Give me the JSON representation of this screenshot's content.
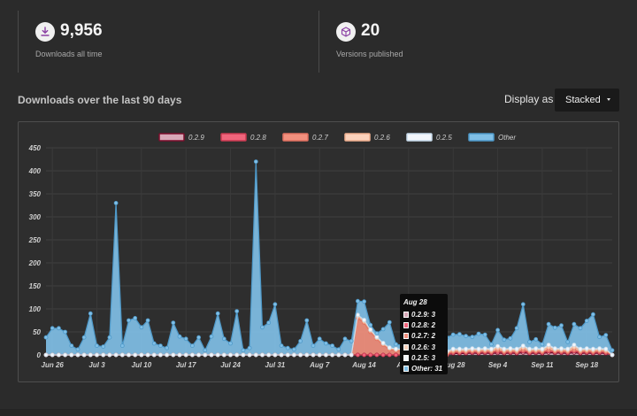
{
  "stats": [
    {
      "icon": "download-icon",
      "value": "9,956",
      "label": "Downloads all time"
    },
    {
      "icon": "package-icon",
      "value": "20",
      "label": "Versions published"
    }
  ],
  "section_title": "Downloads over the last 90 days",
  "display": {
    "label": "Display as",
    "selected": "Stacked"
  },
  "tooltip": {
    "title": "Aug 28",
    "rows": [
      {
        "text": "0.2.9: 3",
        "color": "#d8a8b7"
      },
      {
        "text": "0.2.8: 2",
        "color": "#f0657c"
      },
      {
        "text": "0.2.7: 2",
        "color": "#f2907e"
      },
      {
        "text": "0.2.6: 3",
        "color": "#fbd2bc"
      },
      {
        "text": "0.2.5: 3",
        "color": "#f2f6fb"
      },
      {
        "text": "Other: 31",
        "color": "#80bfe6"
      }
    ]
  },
  "chart_data": {
    "type": "area",
    "stacked": true,
    "legend_position": "top",
    "ylim": [
      0,
      450
    ],
    "yticks": [
      0,
      50,
      100,
      150,
      200,
      250,
      300,
      350,
      400,
      450
    ],
    "xtick_labels": [
      "Jun 26",
      "Jul 3",
      "Jul 10",
      "Jul 17",
      "Jul 24",
      "Jul 31",
      "Aug 7",
      "Aug 14",
      "Aug 21",
      "Aug 28",
      "Sep 4",
      "Sep 11",
      "Sep 18"
    ],
    "x": [
      "Jun 25",
      "Jun 26",
      "Jun 27",
      "Jun 28",
      "Jun 29",
      "Jun 30",
      "Jul 1",
      "Jul 2",
      "Jul 3",
      "Jul 4",
      "Jul 5",
      "Jul 6",
      "Jul 7",
      "Jul 8",
      "Jul 9",
      "Jul 10",
      "Jul 11",
      "Jul 12",
      "Jul 13",
      "Jul 14",
      "Jul 15",
      "Jul 16",
      "Jul 17",
      "Jul 18",
      "Jul 19",
      "Jul 20",
      "Jul 21",
      "Jul 22",
      "Jul 23",
      "Jul 24",
      "Jul 25",
      "Jul 26",
      "Jul 27",
      "Jul 28",
      "Jul 29",
      "Jul 30",
      "Jul 31",
      "Aug 1",
      "Aug 2",
      "Aug 3",
      "Aug 4",
      "Aug 5",
      "Aug 6",
      "Aug 7",
      "Aug 8",
      "Aug 9",
      "Aug 10",
      "Aug 11",
      "Aug 12",
      "Aug 13",
      "Aug 14",
      "Aug 15",
      "Aug 16",
      "Aug 17",
      "Aug 18",
      "Aug 19",
      "Aug 20",
      "Aug 21",
      "Aug 22",
      "Aug 23",
      "Aug 24",
      "Aug 25",
      "Aug 26",
      "Aug 27",
      "Aug 28",
      "Aug 29",
      "Aug 30",
      "Aug 31",
      "Sep 1",
      "Sep 2",
      "Sep 3",
      "Sep 4",
      "Sep 5",
      "Sep 6",
      "Sep 7",
      "Sep 8",
      "Sep 9",
      "Sep 10",
      "Sep 11",
      "Sep 12",
      "Sep 13",
      "Sep 14",
      "Sep 15",
      "Sep 16",
      "Sep 17",
      "Sep 18",
      "Sep 19",
      "Sep 20",
      "Sep 21",
      "Sep 22"
    ],
    "series": [
      {
        "name": "0.2.9",
        "color": "#d8a8b7",
        "stroke": "#7a0d2b",
        "values": [
          0,
          0,
          0,
          0,
          0,
          0,
          0,
          0,
          0,
          0,
          0,
          0,
          0,
          0,
          0,
          0,
          0,
          0,
          0,
          0,
          0,
          0,
          0,
          0,
          0,
          0,
          0,
          0,
          0,
          0,
          0,
          0,
          0,
          0,
          0,
          0,
          0,
          0,
          0,
          0,
          0,
          0,
          0,
          0,
          0,
          0,
          0,
          0,
          0,
          0,
          0,
          0,
          0,
          0,
          0,
          0,
          0,
          0,
          0,
          0,
          0,
          0,
          0,
          0,
          3,
          3,
          3,
          4,
          3,
          4,
          3,
          4,
          3,
          4,
          3,
          5,
          3,
          4,
          3,
          5,
          4,
          4,
          3,
          5,
          3,
          4,
          3,
          4,
          3,
          0
        ]
      },
      {
        "name": "0.2.8",
        "color": "#f0657c",
        "stroke": "#c93a51",
        "values": [
          0,
          0,
          0,
          0,
          0,
          0,
          0,
          0,
          0,
          0,
          0,
          0,
          0,
          0,
          0,
          0,
          0,
          0,
          0,
          0,
          0,
          0,
          0,
          0,
          0,
          0,
          0,
          0,
          0,
          0,
          0,
          0,
          0,
          0,
          0,
          0,
          0,
          0,
          0,
          0,
          0,
          0,
          0,
          0,
          0,
          0,
          0,
          0,
          0,
          0,
          0,
          0,
          0,
          0,
          0,
          0,
          0,
          0,
          0,
          0,
          0,
          0,
          0,
          0,
          2,
          2,
          2,
          2,
          2,
          2,
          2,
          3,
          2,
          2,
          2,
          3,
          2,
          2,
          2,
          3,
          2,
          2,
          2,
          3,
          2,
          2,
          2,
          2,
          2,
          0
        ]
      },
      {
        "name": "0.2.7",
        "color": "#f2907e",
        "stroke": "#e07060",
        "values": [
          0,
          0,
          0,
          0,
          0,
          0,
          0,
          0,
          0,
          0,
          0,
          0,
          0,
          0,
          0,
          0,
          0,
          0,
          0,
          0,
          0,
          0,
          0,
          0,
          0,
          0,
          0,
          0,
          0,
          0,
          0,
          0,
          0,
          0,
          0,
          0,
          0,
          0,
          0,
          0,
          0,
          0,
          0,
          0,
          0,
          0,
          0,
          0,
          0,
          80,
          70,
          50,
          35,
          22,
          12,
          9,
          9,
          7,
          8,
          5,
          5,
          3,
          3,
          2,
          2,
          2,
          2,
          2,
          2,
          2,
          2,
          3,
          2,
          2,
          2,
          3,
          2,
          2,
          2,
          3,
          2,
          2,
          2,
          3,
          2,
          2,
          2,
          2,
          2,
          0
        ]
      },
      {
        "name": "0.2.6",
        "color": "#fbd2bc",
        "stroke": "#f0b090",
        "values": [
          0,
          0,
          0,
          0,
          0,
          0,
          0,
          0,
          0,
          0,
          0,
          0,
          0,
          0,
          0,
          0,
          0,
          0,
          0,
          0,
          0,
          0,
          0,
          0,
          0,
          0,
          0,
          0,
          0,
          0,
          0,
          0,
          0,
          0,
          0,
          0,
          0,
          0,
          0,
          0,
          0,
          0,
          0,
          0,
          0,
          0,
          0,
          0,
          0,
          4,
          3,
          3,
          2,
          2,
          2,
          2,
          2,
          2,
          2,
          2,
          2,
          2,
          3,
          3,
          3,
          3,
          3,
          3,
          3,
          3,
          3,
          5,
          3,
          3,
          3,
          5,
          3,
          3,
          3,
          6,
          3,
          3,
          3,
          6,
          3,
          3,
          3,
          3,
          3,
          0
        ]
      },
      {
        "name": "0.2.5",
        "color": "#f2f6fb",
        "stroke": "#c8dcec",
        "values": [
          0,
          0,
          0,
          0,
          0,
          0,
          0,
          0,
          0,
          0,
          0,
          0,
          0,
          0,
          0,
          0,
          0,
          0,
          0,
          0,
          0,
          0,
          0,
          0,
          0,
          0,
          0,
          0,
          0,
          0,
          0,
          0,
          0,
          0,
          0,
          0,
          0,
          0,
          0,
          0,
          0,
          0,
          0,
          0,
          0,
          0,
          0,
          0,
          0,
          3,
          3,
          2,
          2,
          2,
          2,
          2,
          2,
          2,
          2,
          2,
          2,
          2,
          3,
          3,
          3,
          3,
          3,
          3,
          3,
          3,
          3,
          4,
          3,
          3,
          3,
          4,
          3,
          3,
          3,
          5,
          3,
          3,
          3,
          5,
          3,
          3,
          3,
          3,
          3,
          0
        ]
      },
      {
        "name": "Other",
        "color": "#80bfe6",
        "stroke": "#4d98c8",
        "values": [
          38,
          58,
          58,
          50,
          20,
          12,
          38,
          90,
          20,
          18,
          38,
          330,
          20,
          75,
          80,
          60,
          75,
          25,
          20,
          15,
          70,
          40,
          35,
          20,
          38,
          10,
          40,
          90,
          35,
          25,
          95,
          10,
          15,
          420,
          60,
          70,
          110,
          20,
          15,
          12,
          30,
          75,
          20,
          35,
          25,
          20,
          12,
          35,
          30,
          30,
          40,
          10,
          8,
          30,
          55,
          10,
          8,
          5,
          2,
          20,
          40,
          25,
          25,
          30,
          31,
          32,
          28,
          25,
          33,
          30,
          10,
          35,
          20,
          22,
          45,
          90,
          15,
          20,
          10,
          45,
          45,
          50,
          15,
          45,
          45,
          60,
          75,
          25,
          30,
          10
        ]
      }
    ]
  }
}
